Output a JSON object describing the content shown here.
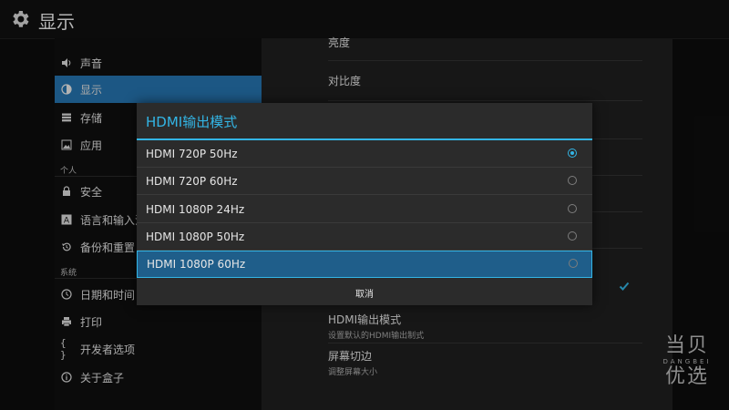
{
  "header": {
    "title": "显示"
  },
  "sidebar": {
    "items": [
      {
        "label": "声音",
        "icon": "speaker-icon",
        "active": false
      },
      {
        "label": "显示",
        "icon": "brightness-icon",
        "active": true
      },
      {
        "label": "存储",
        "icon": "storage-icon",
        "active": false
      },
      {
        "label": "应用",
        "icon": "apps-icon",
        "active": false
      },
      {
        "label": "安全",
        "icon": "lock-icon",
        "active": false
      },
      {
        "label": "语言和输入法",
        "icon": "keyboard-icon",
        "active": false
      },
      {
        "label": "备份和重置",
        "icon": "restore-icon",
        "active": false
      },
      {
        "label": "日期和时间",
        "icon": "clock-icon",
        "active": false
      },
      {
        "label": "打印",
        "icon": "printer-icon",
        "active": false
      },
      {
        "label": "开发者选项",
        "icon": "braces-icon",
        "active": false
      },
      {
        "label": "关于盒子",
        "icon": "info-icon",
        "active": false
      }
    ],
    "section_personal": "个人",
    "section_system": "系统"
  },
  "panel": {
    "rows": [
      {
        "label": "亮度"
      },
      {
        "label": "对比度"
      },
      {
        "label": "HDMI输出模式",
        "sub": "设置默认的HDMI输出制式"
      },
      {
        "label": "屏幕切边",
        "sub": "调整屏幕大小"
      }
    ],
    "checkbox_checked": true
  },
  "dialog": {
    "title": "HDMI输出模式",
    "options": [
      {
        "label": "HDMI 720P 50Hz",
        "checked": true,
        "focused": false
      },
      {
        "label": "HDMI 720P 60Hz",
        "checked": false,
        "focused": false
      },
      {
        "label": "HDMI 1080P 24Hz",
        "checked": false,
        "focused": false
      },
      {
        "label": "HDMI 1080P 50Hz",
        "checked": false,
        "focused": false
      },
      {
        "label": "HDMI 1080P 60Hz",
        "checked": false,
        "focused": true
      }
    ],
    "cancel_label": "取消"
  },
  "watermark": {
    "line1": "当贝",
    "brand": "DANGBEI",
    "line2": "优选"
  },
  "colors": {
    "accent": "#33b5e5",
    "active_item": "#2674b0",
    "focused_option": "#1f5e8a"
  }
}
